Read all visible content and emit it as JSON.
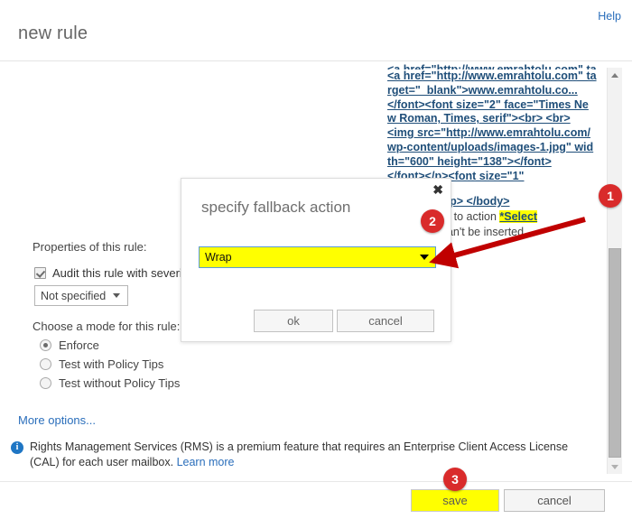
{
  "header": {
    "title": "new rule",
    "help_label": "Help"
  },
  "source_preview": {
    "lines": [
      "<a href=\"http://www.emrahtolu.com\" target=\"_blank\">www.emrahtolu.co...",
      "</font><font size=\"2\" face=\"Times New Roman, Times, serif\"><br> <br>",
      "<img src=\"http://www.emrahtolu.com/wp-content/uploads/images-1.jpg\" width=\"600\" height=\"138\"></font>",
      "</font></p><font size=\"1\"",
      "\"> </font></p> </body>"
    ],
    "description_prefix": "and fall back to action ",
    "description_highlight": "*Select",
    "description_suffix": "disclaimer can't be inserted."
  },
  "form": {
    "properties_label": "Properties of this rule:",
    "audit_checkbox_label": "Audit this rule with severity",
    "audit_checked": true,
    "severity_value": "Not specified",
    "mode_label": "Choose a mode for this rule:",
    "modes": [
      {
        "label": "Enforce",
        "selected": true
      },
      {
        "label": "Test with Policy Tips",
        "selected": false
      },
      {
        "label": "Test without Policy Tips",
        "selected": false
      }
    ],
    "more_options_label": "More options..."
  },
  "info": {
    "icon": "info-icon",
    "text": "Rights Management Services (RMS) is a premium feature that requires an Enterprise Client Access License (CAL) for each user mailbox.",
    "link_label": "Learn more"
  },
  "footer": {
    "save_label": "save",
    "cancel_label": "cancel"
  },
  "dialog": {
    "title": "specify fallback action",
    "close_icon": "✖",
    "select_value": "Wrap",
    "ok_label": "ok",
    "cancel_label": "cancel"
  },
  "annotations": {
    "markers": [
      {
        "id": "1",
        "label": "1"
      },
      {
        "id": "2",
        "label": "2"
      },
      {
        "id": "3",
        "label": "3"
      }
    ],
    "arrow_color": "#c00000",
    "highlight_color": "#ffff00",
    "marker_color": "#d92b2b"
  },
  "scrollbar": {
    "up_icon": "scroll-up-arrow-icon",
    "down_icon": "scroll-down-arrow-icon"
  }
}
